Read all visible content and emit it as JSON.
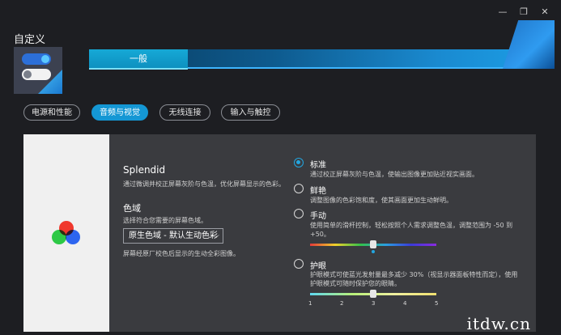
{
  "window": {
    "title": "自定义",
    "controls": {
      "minimize_icon": "—",
      "restore_icon": "❐",
      "close_icon": "✕"
    }
  },
  "tabs": {
    "general_label": "一般"
  },
  "categories": [
    {
      "label": "电源和性能",
      "active": false
    },
    {
      "label": "音频与视觉",
      "active": true
    },
    {
      "label": "无线连接",
      "active": false
    },
    {
      "label": "输入与触控",
      "active": false
    }
  ],
  "splendid": {
    "title": "Splendid",
    "description": "通过微调并校正屏幕灰阶与色温，优化屏幕显示的色彩。",
    "gamut_title": "色域",
    "gamut_description": "选择符合您需要的屏幕色域。",
    "gamut_selected": "原生色域 - 默认生动色彩",
    "gamut_note": "屏幕经原厂校色后显示的生动全彩图像。"
  },
  "modes": {
    "standard": {
      "label": "标准",
      "selected": true,
      "description": "通过校正屏幕灰阶与色温，使输出图像更加贴近视实画面。"
    },
    "vivid": {
      "label": "鲜艳",
      "selected": false,
      "description": "调整图像的色彩饱和度，使其画面更加生动鲜明。"
    },
    "manual": {
      "label": "手动",
      "selected": false,
      "description": "使用简单的滑杆控制，轻松按照个人需求调整色温，调整范围为 -50 到 +50。",
      "slider_value": 0,
      "slider_min": -50,
      "slider_max": 50
    },
    "eyecare": {
      "label": "护眼",
      "selected": false,
      "description": "护眼模式可使蓝光发射量最多减少 30%（视显示器面板特性而定），使用护眼模式可随时保护您的眼睛。",
      "slider_value": 3,
      "ticks": [
        "1",
        "2",
        "3",
        "4",
        "5"
      ]
    }
  },
  "colors": {
    "accent": "#1497d4",
    "card_bg": "#3a3b3f",
    "page_bg": "#1d1e22"
  },
  "watermark": "itdw.cn"
}
